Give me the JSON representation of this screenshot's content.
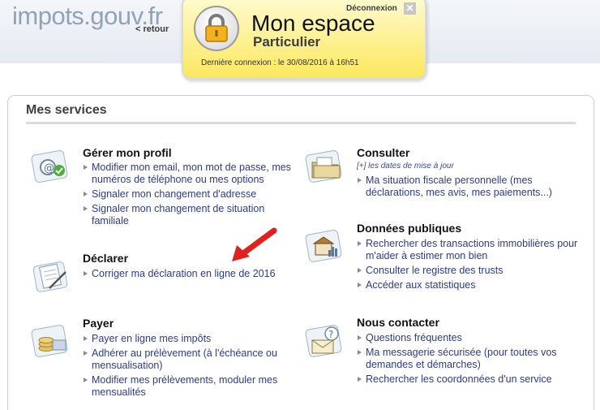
{
  "header": {
    "logo": "impots.gouv.fr",
    "back_link": "< retour"
  },
  "espace": {
    "title": "Mon espace",
    "subtitle": "Particulier",
    "logout": "Déconnexion",
    "close": "✕",
    "last_login": "Dernière connexion : le 30/08/2016 à 16h51"
  },
  "services": {
    "title": "Mes services",
    "profil": {
      "title": "Gérer mon profil",
      "links": [
        "Modifier mon email, mon mot de passe, mes numéros de téléphone ou mes options",
        "Signaler mon changement d'adresse",
        "Signaler mon changement de situation familiale"
      ]
    },
    "declarer": {
      "title": "Déclarer",
      "links": [
        "Corriger ma déclaration en ligne de 2016"
      ]
    },
    "payer": {
      "title": "Payer",
      "links": [
        "Payer en ligne mes impôts",
        "Adhérer au prélèvement (à l'échéance ou mensualisation)",
        "Modifier mes prélèvements, moduler mes mensualités"
      ]
    },
    "consulter": {
      "title": "Consulter",
      "note": "[+] les dates de mise à jour",
      "links": [
        "Ma situation fiscale personnelle (mes déclarations, mes avis, mes paiements...)"
      ]
    },
    "donnees": {
      "title": "Données publiques",
      "links": [
        "Rechercher des transactions immobilières pour m'aider à estimer mon bien",
        "Consulter le registre des trusts",
        "Accéder aux statistiques"
      ]
    },
    "contact": {
      "title": "Nous contacter",
      "links": [
        "Questions fréquentes",
        "Ma messagerie sécurisée (pour toutes vos demandes et démarches)",
        "Rechercher les coordonnées d'un service"
      ]
    }
  },
  "colors": {
    "link": "#2d3c8e",
    "panel_yellow": "#fbe85e",
    "arrow_red": "#e2201e"
  },
  "icons": [
    "lock-icon",
    "profile-icon",
    "declare-icon",
    "pay-icon",
    "consult-icon",
    "public-data-icon",
    "contact-icon",
    "red-arrow-icon"
  ]
}
